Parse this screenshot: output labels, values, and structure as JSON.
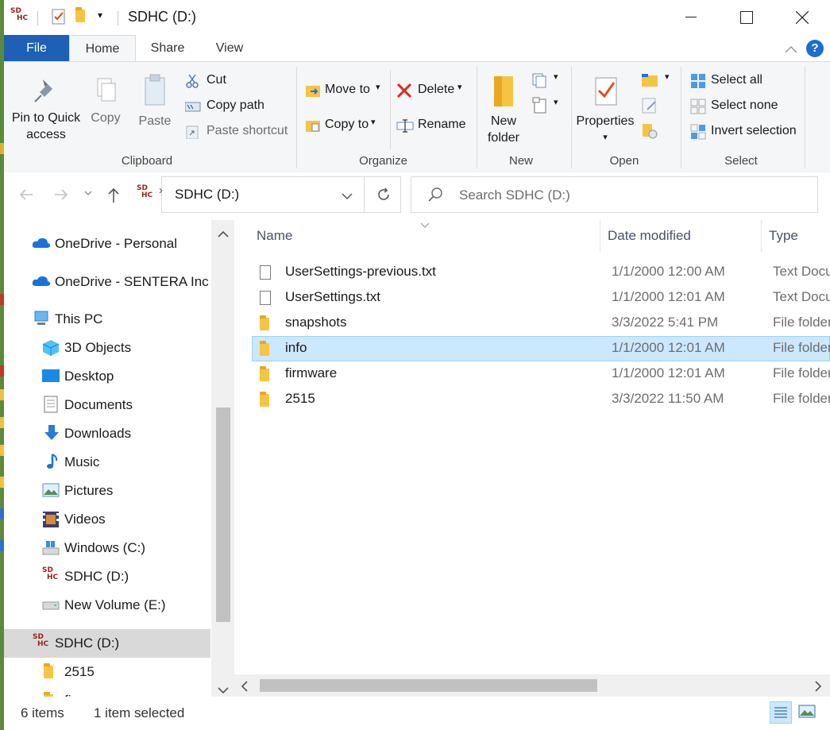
{
  "window": {
    "title": "SDHC (D:)",
    "minimize": "—",
    "maximize": "☐",
    "close": "✕"
  },
  "ribbon_tabs": [
    "File",
    "Home",
    "Share",
    "View"
  ],
  "help_glyph": "?",
  "clipboard": {
    "pin": "Pin to Quick access",
    "pin_line1": "Pin to Quick",
    "pin_line2": "access",
    "copy": "Copy",
    "paste": "Paste",
    "cut": "Cut",
    "copy_path": "Copy path",
    "paste_shortcut": "Paste shortcut",
    "label": "Clipboard"
  },
  "organize": {
    "move_to": "Move to",
    "copy_to": "Copy to",
    "delete": "Delete",
    "rename": "Rename",
    "label": "Organize"
  },
  "new": {
    "new_folder_line1": "New",
    "new_folder_line2": "folder",
    "label": "New"
  },
  "open": {
    "properties": "Properties",
    "label": "Open"
  },
  "select": {
    "select_all": "Select all",
    "select_none": "Select none",
    "invert": "Invert selection",
    "label": "Select"
  },
  "address": {
    "path": "SDHC (D:)",
    "search_placeholder": "Search SDHC (D:)"
  },
  "nav_pane": [
    {
      "label": "OneDrive - Personal",
      "icon": "cloud-icon"
    },
    {
      "label": "OneDrive - SENTERA Inc",
      "icon": "cloud-icon"
    },
    {
      "label": "This PC",
      "icon": "computer-icon"
    },
    {
      "label": "3D Objects",
      "icon": "cube-icon"
    },
    {
      "label": "Desktop",
      "icon": "desktop-icon"
    },
    {
      "label": "Documents",
      "icon": "document-icon"
    },
    {
      "label": "Downloads",
      "icon": "download-icon"
    },
    {
      "label": "Music",
      "icon": "music-icon"
    },
    {
      "label": "Pictures",
      "icon": "pictures-icon"
    },
    {
      "label": "Videos",
      "icon": "videos-icon"
    },
    {
      "label": "Windows (C:)",
      "icon": "drive-windows-icon"
    },
    {
      "label": "SDHC (D:)",
      "icon": "sdhc-icon"
    },
    {
      "label": "New Volume (E:)",
      "icon": "drive-icon"
    },
    {
      "label": "SDHC (D:)",
      "icon": "sdhc-icon"
    },
    {
      "label": "2515",
      "icon": "folder-icon"
    },
    {
      "label": "firmware",
      "icon": "folder-icon"
    }
  ],
  "columns": {
    "name": "Name",
    "date": "Date modified",
    "type": "Type"
  },
  "files": [
    {
      "name": "UserSettings-previous.txt",
      "date": "1/1/2000 12:00 AM",
      "type": "Text Document",
      "kind": "text"
    },
    {
      "name": "UserSettings.txt",
      "date": "1/1/2000 12:01 AM",
      "type": "Text Document",
      "kind": "text"
    },
    {
      "name": "snapshots",
      "date": "3/3/2022 5:41 PM",
      "type": "File folder",
      "kind": "folder"
    },
    {
      "name": "info",
      "date": "1/1/2000 12:01 AM",
      "type": "File folder",
      "kind": "folder"
    },
    {
      "name": "firmware",
      "date": "1/1/2000 12:01 AM",
      "type": "File folder",
      "kind": "folder"
    },
    {
      "name": "2515",
      "date": "3/3/2022 11:50 AM",
      "type": "File folder",
      "kind": "folder"
    }
  ],
  "selected_file": "info",
  "status": {
    "items": "6 items",
    "selected": "1 item selected"
  },
  "colors": {
    "file_tab": "#1e60b5",
    "selection": "#cce8ff",
    "folder": "#f6c443",
    "nav_selected": "#d9d9d9"
  }
}
